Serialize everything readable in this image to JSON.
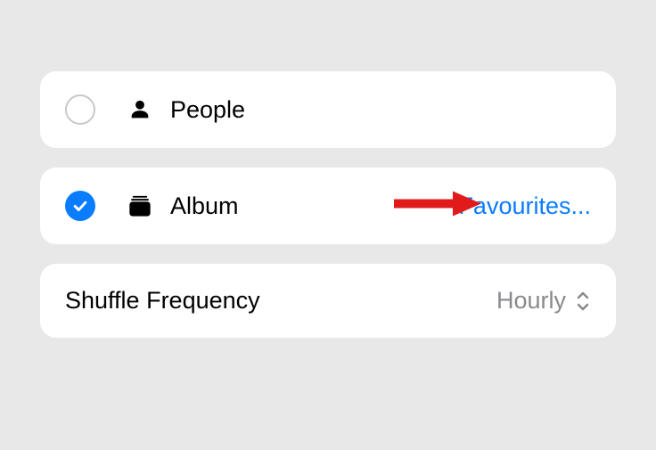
{
  "rows": {
    "people": {
      "label": "People",
      "selected": false
    },
    "album": {
      "label": "Album",
      "link": "Favourites...",
      "selected": true
    },
    "shuffle": {
      "label": "Shuffle Frequency",
      "value": "Hourly"
    }
  }
}
